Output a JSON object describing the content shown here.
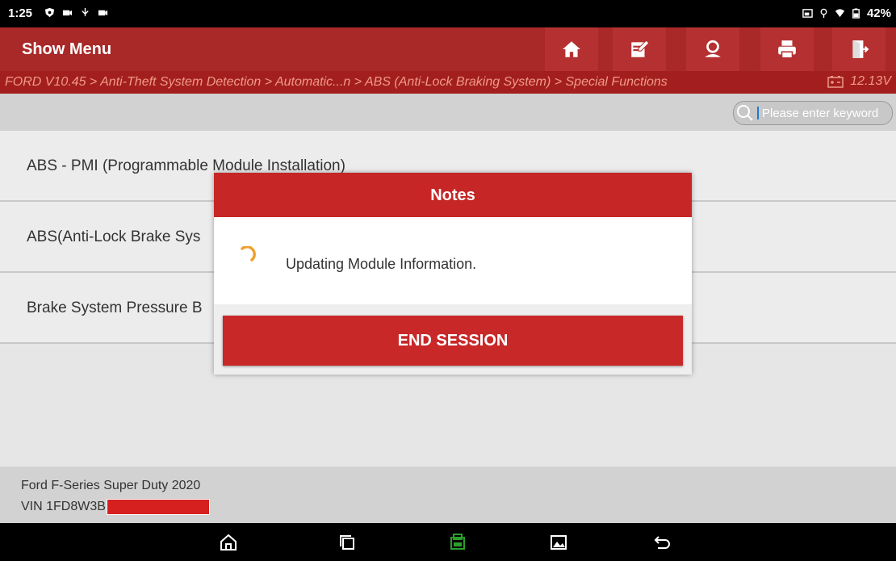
{
  "status": {
    "time": "1:25",
    "battery": "42%"
  },
  "header": {
    "title": "Show Menu"
  },
  "breadcrumb": {
    "path": "FORD V10.45 > Anti-Theft System Detection > Automatic...n > ABS (Anti-Lock Braking System) > Special Functions",
    "voltage": "12.13V"
  },
  "search": {
    "placeholder": "Please enter keyword"
  },
  "menu_items": [
    "ABS - PMI (Programmable Module Installation)",
    "ABS(Anti-Lock Brake Sys",
    "Brake System Pressure B"
  ],
  "dialog": {
    "title": "Notes",
    "message": "Updating Module Information.",
    "end_button": "END SESSION"
  },
  "footer": {
    "vehicle": "Ford F-Series Super Duty 2020",
    "vin_prefix": "VIN 1FD8W3B"
  },
  "colors": {
    "brand_red": "#a92828",
    "accent_orange": "#f0a030"
  },
  "icons": [
    "home-icon",
    "edit-icon",
    "user-icon",
    "print-icon",
    "exit-icon",
    "search-icon",
    "battery-icon"
  ]
}
